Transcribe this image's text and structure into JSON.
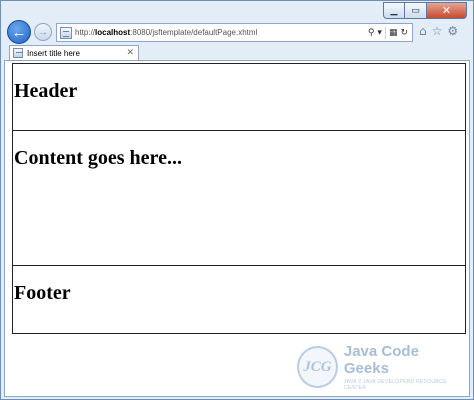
{
  "browser": {
    "url_prefix": "http://",
    "url_host": "localhost",
    "url_rest": ":8080/jsftemplate/defaultPage.xhtml",
    "tab_title": "Insert title here"
  },
  "page": {
    "header": "Header",
    "content": "Content goes here...",
    "footer": "Footer"
  },
  "watermark": {
    "badge": "JCG",
    "title": "Java Code Geeks",
    "subtitle": "JAVA 2 JAVA DEVELOPERS RESOURCE CENTER"
  }
}
